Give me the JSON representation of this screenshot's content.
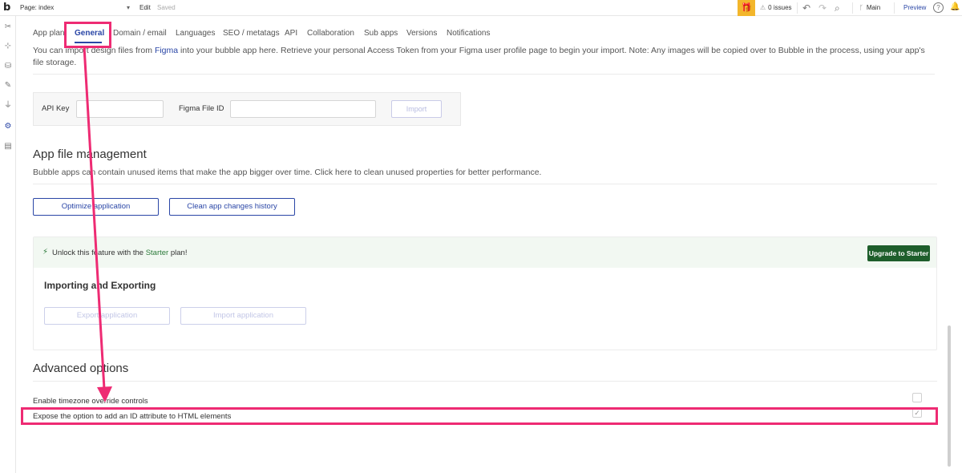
{
  "topbar": {
    "logo": "b",
    "page_select": "Page: index",
    "edit": "Edit",
    "saved": "Saved",
    "issues": "0 issues",
    "branch": "Main",
    "preview": "Preview",
    "help": "?"
  },
  "tabs": [
    "App plan",
    "General",
    "Domain / email",
    "Languages",
    "SEO / metatags",
    "API",
    "Collaboration",
    "Sub apps",
    "Versions",
    "Notifications"
  ],
  "figma": {
    "desc_before": "You can import design files from ",
    "desc_link": "Figma",
    "desc_after": " into your bubble app here. Retrieve your personal Access Token from your Figma user profile page to begin your import. Note: Any images will be copied over to Bubble in the process, using your app's file storage.",
    "api_key_label": "API Key",
    "file_id_label": "Figma File ID",
    "import_button": "Import"
  },
  "file_management": {
    "title": "App file management",
    "subtitle": "Bubble apps can contain unused items that make the app bigger over time. Click here to clean unused properties for better performance.",
    "optimize_button": "Optimize application",
    "clean_button": "Clean app changes history"
  },
  "starter": {
    "unlock_before": "Unlock this feature with the ",
    "unlock_plan": "Starter",
    "unlock_after": " plan!",
    "upgrade_button": "Upgrade to Starter",
    "title": "Importing and Exporting",
    "export_button": "Export application",
    "import_button": "Import application"
  },
  "advanced": {
    "title": "Advanced options",
    "option_timezone": "Enable timezone override controls",
    "option_timezone_checked": false,
    "option_id_attr": "Expose the option to add an ID attribute to HTML elements",
    "option_id_attr_checked": true
  },
  "colors": {
    "accent": "#2a46a6",
    "annotation": "#ee2b73",
    "upgrade": "#1e5e2b",
    "gift": "#f3b62b"
  }
}
